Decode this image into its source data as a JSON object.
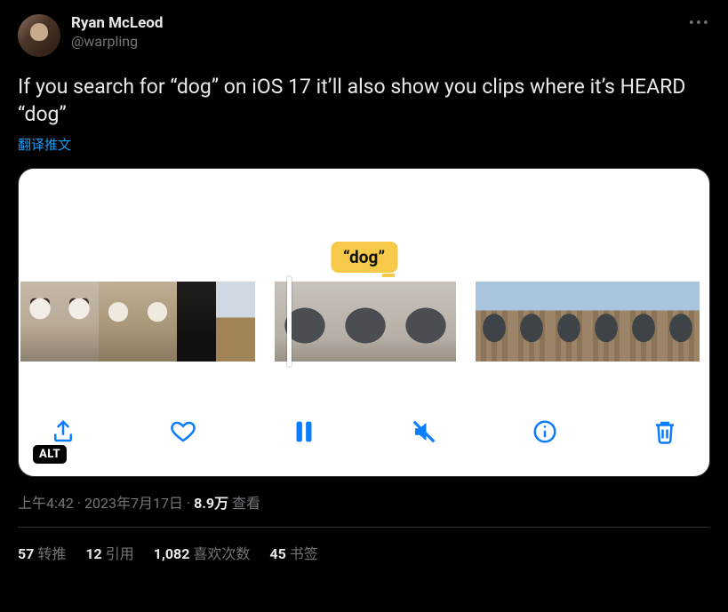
{
  "author": {
    "display_name": "Ryan McLeod",
    "handle": "@warpling"
  },
  "tweet_text": "If you search for “dog” on iOS 17 it’ll also show you clips where it’s HEARD “dog”",
  "translate_label": "翻译推文",
  "media": {
    "search_term": "“dog”",
    "alt_badge": "ALT",
    "toolbar": {
      "share": "share",
      "like": "like",
      "pause": "pause",
      "mute": "mute",
      "info": "info",
      "delete": "delete"
    }
  },
  "meta": {
    "time": "上午4:42",
    "date": "2023年7月17日",
    "sep": " · ",
    "views_number": "8.9万",
    "views_label": " 查看"
  },
  "stats": {
    "retweets": {
      "count": "57",
      "label": "转推"
    },
    "quotes": {
      "count": "12",
      "label": "引用"
    },
    "likes": {
      "count": "1,082",
      "label": "喜欢次数"
    },
    "bookmarks": {
      "count": "45",
      "label": "书签"
    }
  }
}
